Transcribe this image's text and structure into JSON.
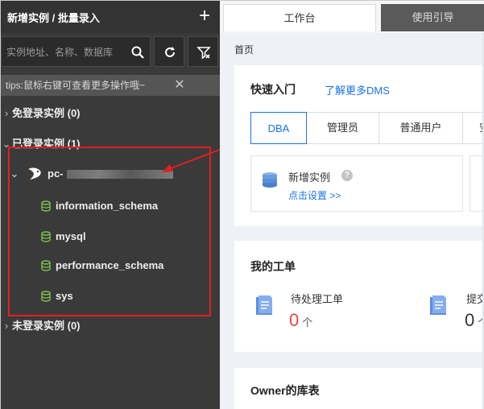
{
  "sidebar": {
    "title": "新增实例 / 批量录入",
    "add_label": "+",
    "search_placeholder": "实例地址、名称、数据库",
    "tips": "tips:鼠标右键可查看更多操作哦~",
    "tips_close": "✕",
    "groups": {
      "free": "免登录实例 (0)",
      "logged": "已登录实例 (1)",
      "unlogged": "未登录实例 (0)"
    },
    "instance": {
      "name_visible": "pc-"
    },
    "databases": [
      "information_schema",
      "mysql",
      "performance_schema",
      "sys"
    ]
  },
  "tabs": {
    "workbench": "工作台",
    "guide": "使用引导"
  },
  "breadcrumb": "首页",
  "quick_start": {
    "title": "快速入门",
    "link": "了解更多DMS",
    "roles": [
      "DBA",
      "管理员",
      "普通用户",
      "安"
    ],
    "new_instance_label": "新增实例",
    "help": "?",
    "setup_link": "点击设置 >>"
  },
  "tickets": {
    "title": "我的工单",
    "pending_label": "待处理工单",
    "pending_count": "0",
    "pending_unit": "个",
    "submitted_label": "提交",
    "submitted_count": "0",
    "submitted_unit": "个"
  },
  "owner": {
    "title": "Owner的库表"
  },
  "colors": {
    "accent": "#1a73e8",
    "highlight_box": "#e02020",
    "sidebar_bg": "#3a3a3a",
    "db_icon": "#7cc24a",
    "pending_count": "#e44444"
  }
}
